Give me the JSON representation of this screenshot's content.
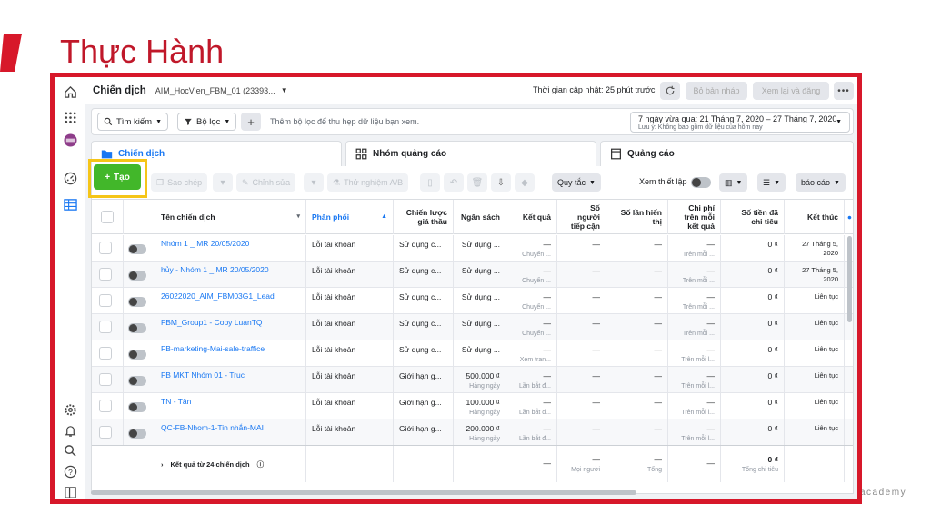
{
  "slide": {
    "title": "Thực Hành",
    "brand": "academy"
  },
  "topbar": {
    "title": "Chiến dịch",
    "account": "AIM_HocVien_FBM_01 (23393...",
    "updated": "Thời gian cập nhật: 25 phút trước",
    "draft_btn": "Bỏ bản nháp",
    "review_btn": "Xem lại và đăng"
  },
  "filters": {
    "search": "Tìm kiếm",
    "filter": "Bộ lọc",
    "placeholder": "Thêm bộ lọc để thu hẹp dữ liệu bạn xem.",
    "date_range": "7 ngày vừa qua: 21 Tháng 7, 2020 – 27 Tháng 7, 2020",
    "date_note": "Lưu ý: Không bao gồm dữ liệu của hôm nay"
  },
  "tabs": [
    {
      "label": "Chiến dịch"
    },
    {
      "label": "Nhóm quảng cáo"
    },
    {
      "label": "Quảng cáo"
    }
  ],
  "toolbar": {
    "create": "Tạo",
    "duplicate": "Sao chép",
    "edit": "Chỉnh sửa",
    "ab_test": "Thử nghiệm A/B",
    "rules": "Quy tắc",
    "view_setup": "Xem thiết lập",
    "reports": "báo cáo"
  },
  "columns": {
    "name": "Tên chiến dịch",
    "delivery": "Phân phối",
    "bid_strategy_1": "Chiến lược",
    "bid_strategy_2": "giá thầu",
    "budget": "Ngân sách",
    "results": "Kết quả",
    "reach_1": "Số",
    "reach_2": "người",
    "reach_3": "tiếp cận",
    "impressions_1": "Số lần hiển",
    "impressions_2": "thị",
    "cost_1": "Chi phí",
    "cost_2": "trên mỗi",
    "cost_3": "kết quả",
    "spent_1": "Số tiền đã",
    "spent_2": "chi tiêu",
    "ends": "Kết thúc"
  },
  "rows": [
    {
      "name": "Nhóm 1 _ MR 20/05/2020",
      "delivery": "Lỗi tài khoản",
      "bid": "Sử dụng c...",
      "budget": "Sử dụng ...",
      "budget_sub": "",
      "result": "—",
      "result_sub": "Chuyển ...",
      "reach": "—",
      "impr": "—",
      "cost": "—",
      "cost_sub": "Trên mỗi ...",
      "spent": "0 ₫",
      "ends_1": "27 Tháng 5,",
      "ends_2": "2020"
    },
    {
      "name": "hủy - Nhóm 1 _ MR 20/05/2020",
      "delivery": "Lỗi tài khoản",
      "bid": "Sử dụng c...",
      "budget": "Sử dụng ...",
      "budget_sub": "",
      "result": "—",
      "result_sub": "Chuyển ...",
      "reach": "—",
      "impr": "—",
      "cost": "—",
      "cost_sub": "Trên mỗi ...",
      "spent": "0 ₫",
      "ends_1": "27 Tháng 5,",
      "ends_2": "2020"
    },
    {
      "name": "26022020_AIM_FBM03G1_Lead",
      "delivery": "Lỗi tài khoản",
      "bid": "Sử dụng c...",
      "budget": "Sử dụng ...",
      "budget_sub": "",
      "result": "—",
      "result_sub": "Chuyển ...",
      "reach": "—",
      "impr": "—",
      "cost": "—",
      "cost_sub": "Trên mỗi ...",
      "spent": "0 ₫",
      "ends_1": "Liên tục",
      "ends_2": ""
    },
    {
      "name": "FBM_Group1 - Copy LuanTQ",
      "delivery": "Lỗi tài khoản",
      "bid": "Sử dụng c...",
      "budget": "Sử dụng ...",
      "budget_sub": "",
      "result": "—",
      "result_sub": "Chuyển ...",
      "reach": "—",
      "impr": "—",
      "cost": "—",
      "cost_sub": "Trên mỗi ...",
      "spent": "0 ₫",
      "ends_1": "Liên tục",
      "ends_2": ""
    },
    {
      "name": "FB-marketing-Mai-sale-traffice",
      "delivery": "Lỗi tài khoản",
      "bid": "Sử dụng c...",
      "budget": "Sử dụng ...",
      "budget_sub": "",
      "result": "—",
      "result_sub": "Xem tran...",
      "reach": "—",
      "impr": "—",
      "cost": "—",
      "cost_sub": "Trên mỗi l...",
      "spent": "0 ₫",
      "ends_1": "Liên tục",
      "ends_2": ""
    },
    {
      "name": "FB MKT Nhóm 01 - Truc",
      "delivery": "Lỗi tài khoản",
      "bid": "Giới hạn g...",
      "budget": "500.000 ₫",
      "budget_sub": "Hàng ngày",
      "result": "—",
      "result_sub": "Lần bắt đ...",
      "reach": "—",
      "impr": "—",
      "cost": "—",
      "cost_sub": "Trên mỗi l...",
      "spent": "0 ₫",
      "ends_1": "Liên tục",
      "ends_2": ""
    },
    {
      "name": "TN - Tân",
      "delivery": "Lỗi tài khoản",
      "bid": "Giới hạn g...",
      "budget": "100.000 ₫",
      "budget_sub": "Hàng ngày",
      "result": "—",
      "result_sub": "Lần bắt đ...",
      "reach": "—",
      "impr": "—",
      "cost": "—",
      "cost_sub": "Trên mỗi l...",
      "spent": "0 ₫",
      "ends_1": "Liên tục",
      "ends_2": ""
    },
    {
      "name": "QC-FB-Nhom-1-Tin nhắn-MAI",
      "delivery": "Lỗi tài khoản",
      "bid": "Giới hạn g...",
      "budget": "200.000 ₫",
      "budget_sub": "Hàng ngày",
      "result": "—",
      "result_sub": "Lần bắt đ...",
      "reach": "—",
      "impr": "—",
      "cost": "—",
      "cost_sub": "Trên mỗi l...",
      "spent": "0 ₫",
      "ends_1": "Liên tục",
      "ends_2": ""
    }
  ],
  "totals": {
    "label": "Kết quả từ 24 chiến dịch",
    "result": "—",
    "result_sub": "",
    "reach": "—",
    "reach_sub": "Mọi người",
    "impr": "—",
    "impr_sub": "Tổng",
    "cost": "—",
    "cost_sub": "",
    "spent": "0 ₫",
    "spent_sub": "Tổng chi tiêu"
  },
  "colors": {
    "accent": "#d7182a",
    "fb_blue": "#1877f2",
    "create_green": "#42b72a",
    "highlight": "#f5c518"
  }
}
